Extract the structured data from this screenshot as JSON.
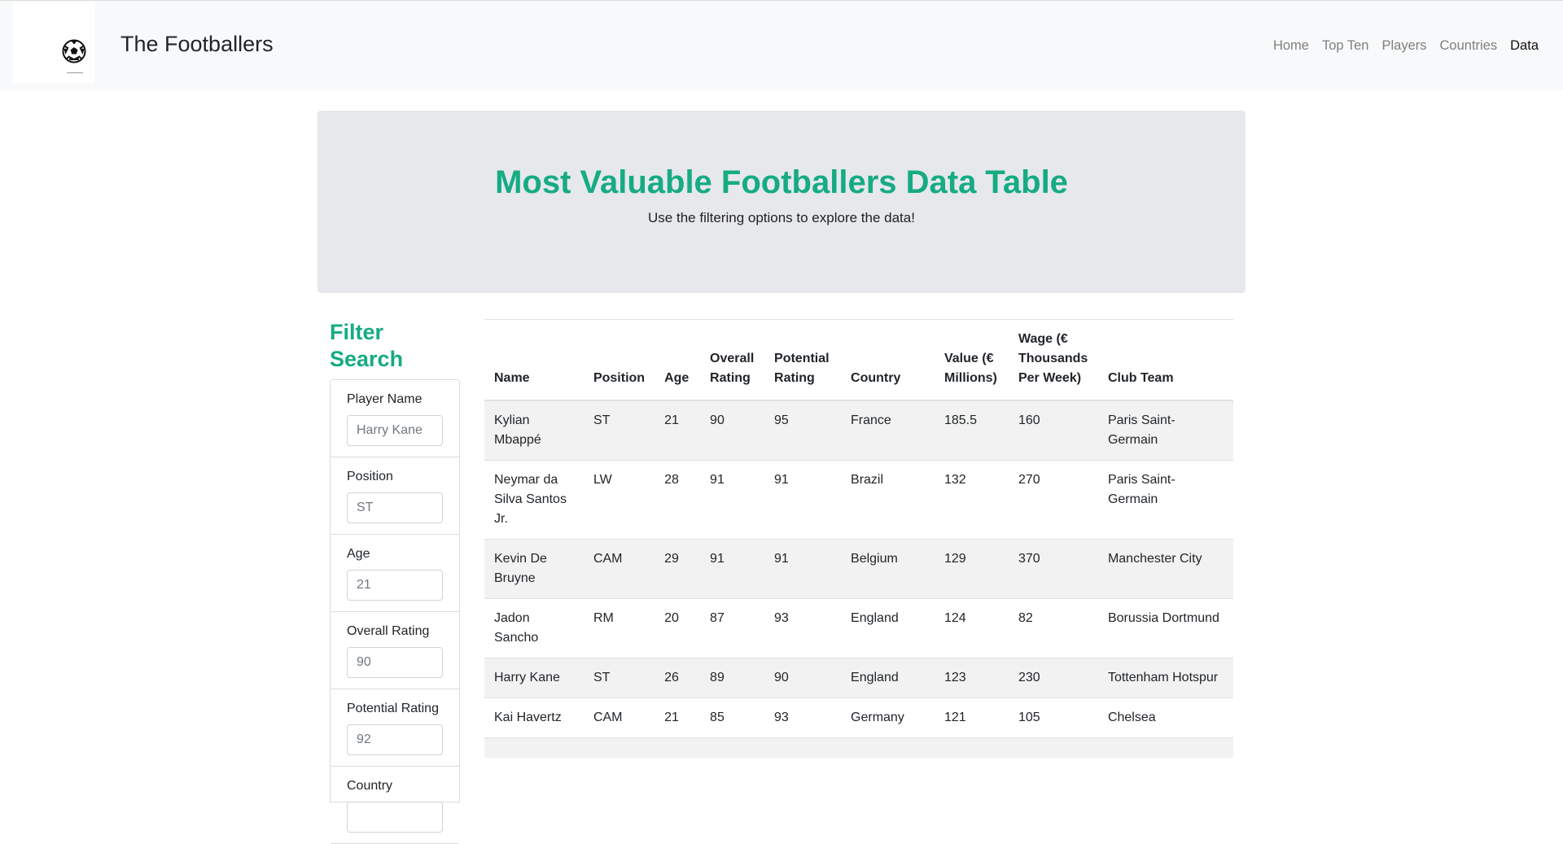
{
  "navbar": {
    "brand": "The Footballers",
    "links": [
      {
        "label": "Home"
      },
      {
        "label": "Top Ten"
      },
      {
        "label": "Players"
      },
      {
        "label": "Countries"
      },
      {
        "label": "Data",
        "active": true
      }
    ]
  },
  "jumbotron": {
    "title": "Most Valuable Footballers Data Table",
    "subtitle": "Use the filtering options to explore the data!"
  },
  "filter": {
    "title": "Filter Search",
    "fields": [
      {
        "label": "Player Name",
        "placeholder": "Harry Kane"
      },
      {
        "label": "Position",
        "placeholder": "ST"
      },
      {
        "label": "Age",
        "placeholder": "21"
      },
      {
        "label": "Overall Rating",
        "placeholder": "90"
      },
      {
        "label": "Potential Rating",
        "placeholder": "92"
      },
      {
        "label": "Country",
        "placeholder": ""
      }
    ]
  },
  "table": {
    "headers": [
      "Name",
      "Position",
      "Age",
      "Overall Rating",
      "Potential Rating",
      "Country",
      "Value (€ Millions)",
      "Wage (€ Thousands Per Week)",
      "Club Team"
    ],
    "rows": [
      [
        "Kylian Mbappé",
        "ST",
        "21",
        "90",
        "95",
        "France",
        "185.5",
        "160",
        "Paris Saint-Germain"
      ],
      [
        "Neymar da Silva Santos Jr.",
        "LW",
        "28",
        "91",
        "91",
        "Brazil",
        "132",
        "270",
        "Paris Saint-Germain"
      ],
      [
        "Kevin De Bruyne",
        "CAM",
        "29",
        "91",
        "91",
        "Belgium",
        "129",
        "370",
        "Manchester City"
      ],
      [
        "Jadon Sancho",
        "RM",
        "20",
        "87",
        "93",
        "England",
        "124",
        "82",
        "Borussia Dortmund"
      ],
      [
        "Harry Kane",
        "ST",
        "26",
        "89",
        "90",
        "England",
        "123",
        "230",
        "Tottenham Hotspur"
      ],
      [
        "Kai Havertz",
        "CAM",
        "21",
        "85",
        "93",
        "Germany",
        "121",
        "105",
        "Chelsea"
      ],
      [
        "",
        "",
        "",
        "",
        "",
        "",
        "",
        "",
        ""
      ]
    ]
  },
  "colors": {
    "accent": "#16ab83",
    "navbar_bg": "#f8f9fa",
    "jumbotron_bg": "#e6e8ec",
    "stripe": "#f2f2f2"
  }
}
